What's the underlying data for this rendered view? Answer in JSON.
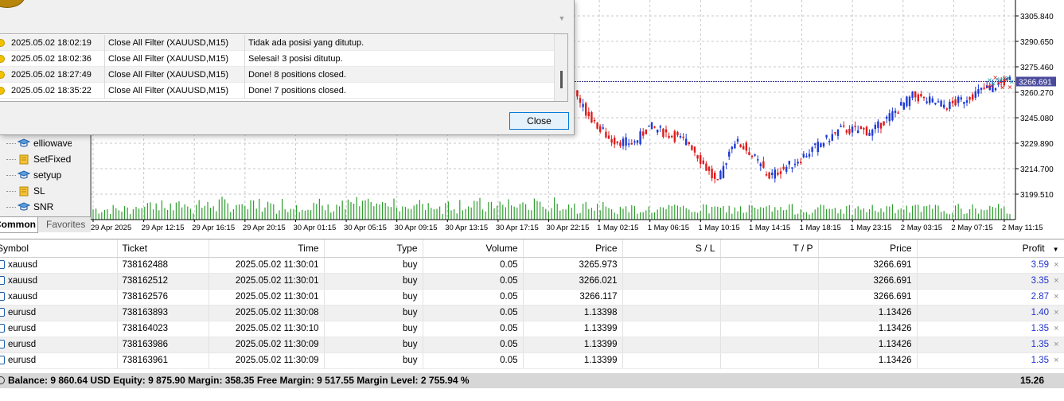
{
  "chart": {
    "price_ticks": [
      "3305.840",
      "3290.650",
      "3275.460",
      "3260.270",
      "3245.080",
      "3229.890",
      "3214.700",
      "3199.510"
    ],
    "current_price": "3266.691",
    "time_ticks": [
      "29 Apr 2025",
      "29 Apr 12:15",
      "29 Apr 16:15",
      "29 Apr 20:15",
      "30 Apr 01:15",
      "30 Apr 05:15",
      "30 Apr 09:15",
      "30 Apr 13:15",
      "30 Apr 17:15",
      "30 Apr 22:15",
      "1 May 02:15",
      "1 May 06:15",
      "1 May 10:15",
      "1 May 14:15",
      "1 May 18:15",
      "1 May 23:15",
      "2 May 03:15",
      "2 May 07:15",
      "2 May 11:15"
    ],
    "bull_color": "#1f3bd6",
    "bear_color": "#e01b1b",
    "volume_color": "#2e9e2e"
  },
  "dialog": {
    "log": [
      {
        "time": "2025.05.02 18:02:19",
        "source": "Close All Filter (XAUUSD,M15)",
        "message": "Tidak ada posisi yang ditutup."
      },
      {
        "time": "2025.05.02 18:02:36",
        "source": "Close All Filter (XAUUSD,M15)",
        "message": "Selesai! 3 posisi ditutup."
      },
      {
        "time": "2025.05.02 18:27:49",
        "source": "Close All Filter (XAUUSD,M15)",
        "message": "Done! 8 positions closed."
      },
      {
        "time": "2025.05.02 18:35:22",
        "source": "Close All Filter (XAUUSD,M15)",
        "message": "Done! 7 positions closed."
      }
    ],
    "close_label": "Close"
  },
  "navigator": {
    "items": [
      {
        "label": "elliowave",
        "icon": "expert-hat-icon"
      },
      {
        "label": "SetFixedSL",
        "icon": "script-icon"
      },
      {
        "label": "setyup",
        "icon": "expert-hat-icon"
      },
      {
        "label": "SL",
        "icon": "script-icon"
      },
      {
        "label": "SNR",
        "icon": "expert-hat-icon"
      }
    ],
    "tabs": {
      "common": "Common",
      "favorites": "Favorites"
    }
  },
  "trade": {
    "headers": {
      "symbol": "Symbol",
      "ticket": "Ticket",
      "time": "Time",
      "type": "Type",
      "volume": "Volume",
      "price": "Price",
      "sl": "S / L",
      "tp": "T / P",
      "cur_price": "Price",
      "profit": "Profit"
    },
    "sort_indicator": "▼",
    "rows": [
      {
        "symbol": "xauusd",
        "ticket": "738162488",
        "time": "2025.05.02 11:30:01",
        "type": "buy",
        "volume": "0.05",
        "price": "3265.973",
        "sl": "",
        "tp": "",
        "cur_price": "3266.691",
        "profit": "3.59"
      },
      {
        "symbol": "xauusd",
        "ticket": "738162512",
        "time": "2025.05.02 11:30:01",
        "type": "buy",
        "volume": "0.05",
        "price": "3266.021",
        "sl": "",
        "tp": "",
        "cur_price": "3266.691",
        "profit": "3.35"
      },
      {
        "symbol": "xauusd",
        "ticket": "738162576",
        "time": "2025.05.02 11:30:01",
        "type": "buy",
        "volume": "0.05",
        "price": "3266.117",
        "sl": "",
        "tp": "",
        "cur_price": "3266.691",
        "profit": "2.87"
      },
      {
        "symbol": "eurusd",
        "ticket": "738163893",
        "time": "2025.05.02 11:30:08",
        "type": "buy",
        "volume": "0.05",
        "price": "1.13398",
        "sl": "",
        "tp": "",
        "cur_price": "1.13426",
        "profit": "1.40"
      },
      {
        "symbol": "eurusd",
        "ticket": "738164023",
        "time": "2025.05.02 11:30:10",
        "type": "buy",
        "volume": "0.05",
        "price": "1.13399",
        "sl": "",
        "tp": "",
        "cur_price": "1.13426",
        "profit": "1.35"
      },
      {
        "symbol": "eurusd",
        "ticket": "738163986",
        "time": "2025.05.02 11:30:09",
        "type": "buy",
        "volume": "0.05",
        "price": "1.13399",
        "sl": "",
        "tp": "",
        "cur_price": "1.13426",
        "profit": "1.35"
      },
      {
        "symbol": "eurusd",
        "ticket": "738163961",
        "time": "2025.05.02 11:30:09",
        "type": "buy",
        "volume": "0.05",
        "price": "1.13399",
        "sl": "",
        "tp": "",
        "cur_price": "1.13426",
        "profit": "1.35"
      }
    ],
    "close_glyph": "×",
    "balance_text": "Balance: 9 860.64 USD  Equity: 9 875.90  Margin: 358.35  Free Margin: 9 517.55  Margin Level: 2 755.94 %",
    "total_profit": "15.26"
  }
}
